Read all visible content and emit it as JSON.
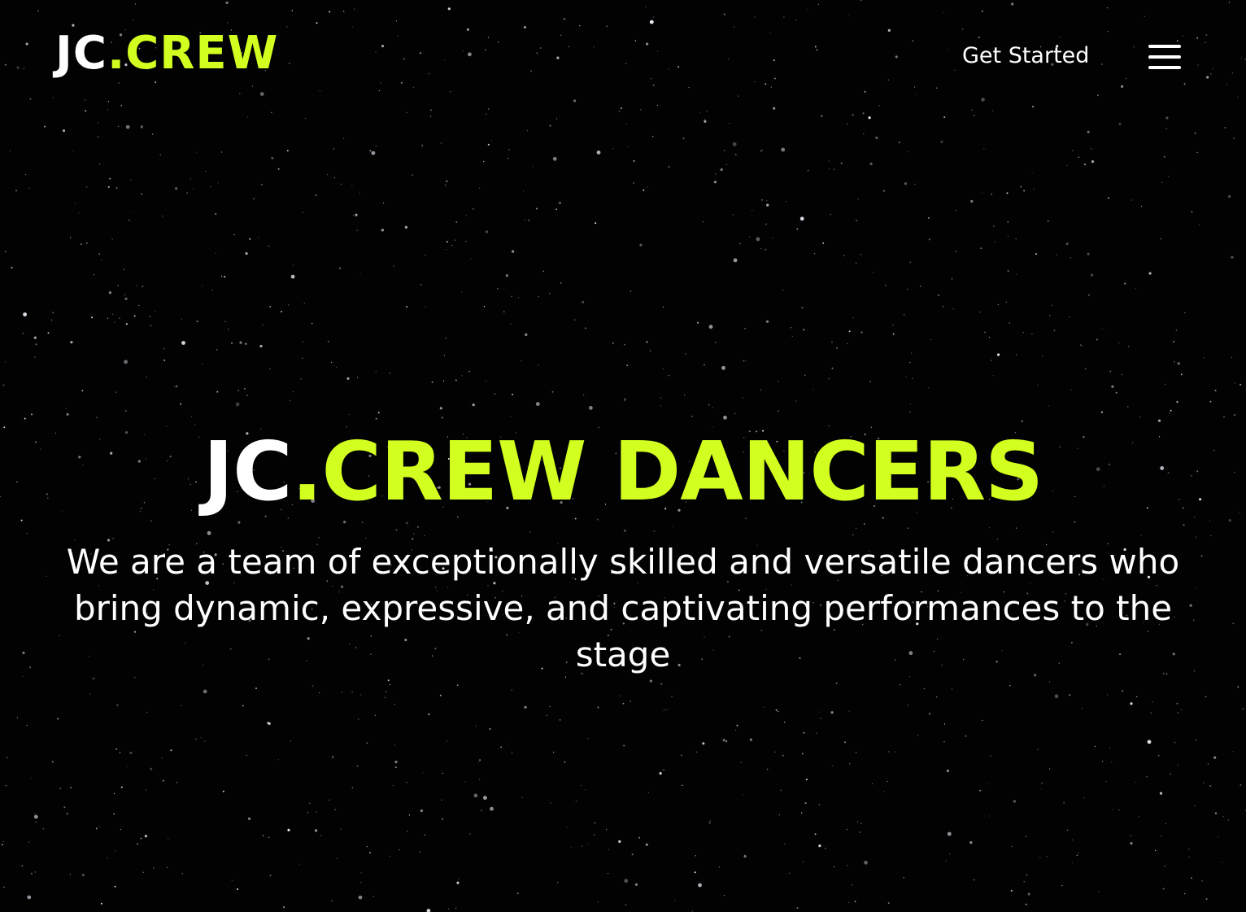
{
  "header": {
    "logo": {
      "prefix": "JC",
      "suffix": ".CREW"
    },
    "get_started_label": "Get Started",
    "menu_icon": "hamburger-menu-icon"
  },
  "hero": {
    "title": {
      "prefix": "JC",
      "suffix": ".CREW DANCERS"
    },
    "description": "We are a team of exceptionally skilled and versatile dancers who bring dynamic, expressive, and captivating performances to the stage"
  },
  "colors": {
    "background": "#020203",
    "accent": "#d2ff1f",
    "text": "#ffffff"
  }
}
